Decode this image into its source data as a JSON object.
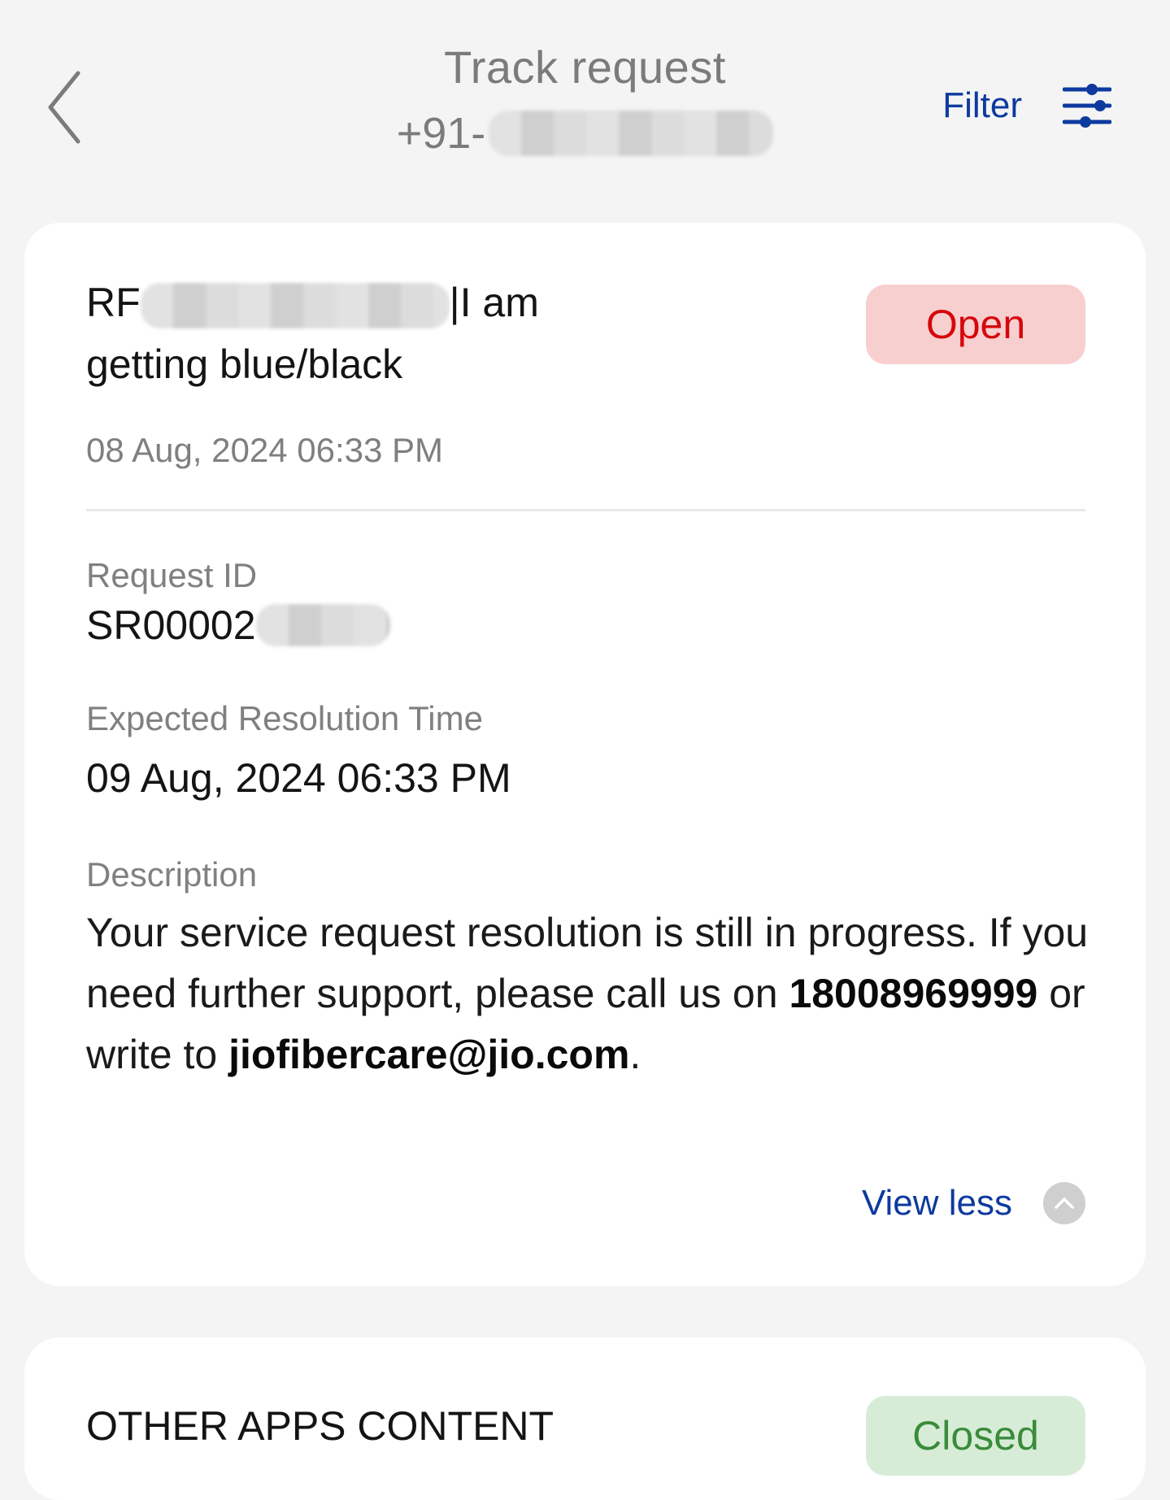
{
  "header": {
    "title": "Track request",
    "phone_prefix": "+91-"
  },
  "filter": {
    "label": "Filter"
  },
  "requests": [
    {
      "title_prefix": "RF",
      "title_suffix": "|I am",
      "title_line2": "getting blue/black",
      "status": "Open",
      "date": "08 Aug, 2024 06:33 PM",
      "request_id_label": "Request ID",
      "request_id": "SR00002",
      "expected_label": "Expected Resolution Time",
      "expected_value": "09 Aug, 2024 06:33 PM",
      "description_label": "Description",
      "description_part1": "Your service request resolution is still in progress. If you need further support, please call us on ",
      "description_phone": "18008969999",
      "description_part2": " or write to ",
      "description_email": "jiofibercare@jio.com",
      "description_end": ".",
      "view_less": "View less"
    },
    {
      "title": "OTHER APPS CONTENT",
      "status": "Closed"
    }
  ],
  "colors": {
    "accent": "#0d3a9e",
    "open_bg": "#f8cfcf",
    "open_text": "#d6060c",
    "closed_bg": "#d6ecd6",
    "closed_text": "#3a8b3a"
  }
}
